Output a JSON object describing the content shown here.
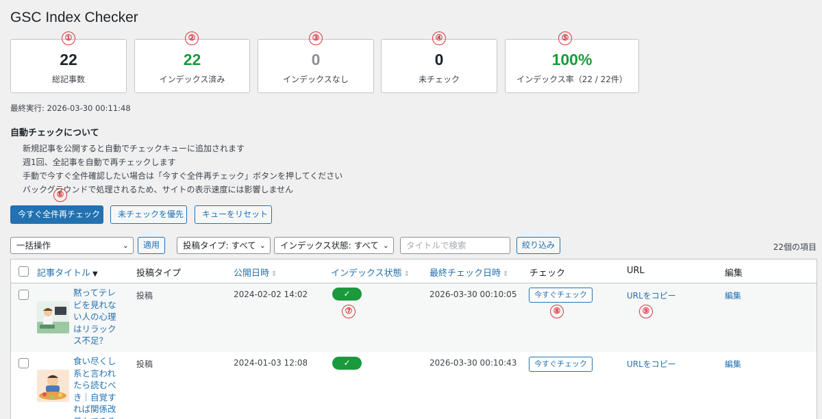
{
  "page_title": "GSC Index Checker",
  "stats": [
    {
      "value": "22",
      "label": "総記事数",
      "marker": "①"
    },
    {
      "value": "22",
      "label": "インデックス済み",
      "marker": "②"
    },
    {
      "value": "0",
      "label": "インデックスなし",
      "marker": "③"
    },
    {
      "value": "0",
      "label": "未チェック",
      "marker": "④"
    },
    {
      "value": "100%",
      "label": "インデックス率（22 / 22件）",
      "marker": "⑤"
    }
  ],
  "last_run": "最終実行: 2026-03-30 00:11:48",
  "auto_check": {
    "title": "自動チェックについて",
    "items": [
      "新規記事を公開すると自動でチェックキューに追加されます",
      "週1回、全記事を自動で再チェックします",
      "手動で今すぐ全件確認したい場合は「今すぐ全件再チェック」ボタンを押してください",
      "バックグラウンドで処理されるため、サイトの表示速度には影響しません"
    ]
  },
  "markers": {
    "m6": "⑥",
    "m7": "⑦",
    "m8": "⑧",
    "m9": "⑨"
  },
  "actions": {
    "recheck_all": "今すぐ全件再チェック",
    "prioritize_unchecked": "未チェックを優先",
    "reset_queue": "キューをリセット"
  },
  "filters": {
    "bulk_action": "一括操作",
    "apply": "適用",
    "post_type": "投稿タイプ: すべて",
    "index_status": "インデックス状態: すべて",
    "search_placeholder": "タイトルで検索",
    "filter_button": "絞り込み",
    "item_count": "22個の項目"
  },
  "table": {
    "headers": {
      "title": "記事タイトル",
      "post_type": "投稿タイプ",
      "published": "公開日時",
      "index_status": "インデックス状態",
      "last_checked": "最終チェック日時",
      "check": "チェック",
      "url": "URL",
      "edit": "編集"
    },
    "rows": [
      {
        "title": "黙ってテレビを見れない人の心理はリラックス不足？",
        "post_type": "投稿",
        "published": "2024-02-02 14:02",
        "status": "✓",
        "last_checked": "2026-03-30 00:10:05",
        "check_btn": "今すぐチェック",
        "url_copy": "URLをコピー",
        "edit": "編集"
      },
      {
        "title": "食い尽くし系と言われたら読むべき｜自覚すれば関係改善もできる",
        "post_type": "投稿",
        "published": "2024-01-03 12:08",
        "status": "✓",
        "last_checked": "2026-03-30 00:10:43",
        "check_btn": "今すぐチェック",
        "url_copy": "URLをコピー",
        "edit": "編集"
      }
    ]
  },
  "colors": {
    "primary": "#2271b1",
    "success": "#1a9a3c",
    "marker": "#d63638",
    "muted": "#8c8f94"
  }
}
